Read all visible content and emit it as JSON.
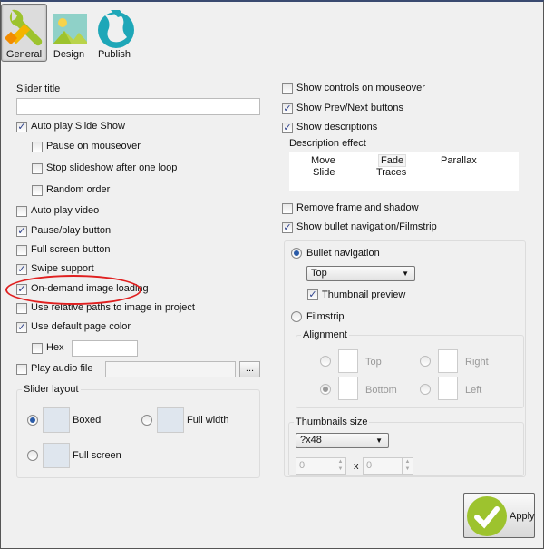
{
  "tabs": [
    {
      "label": "General",
      "selected": true,
      "icon": "wrench-icon"
    },
    {
      "label": "Design",
      "selected": false,
      "icon": "picture-icon"
    },
    {
      "label": "Publish",
      "selected": false,
      "icon": "globe-icon"
    }
  ],
  "left": {
    "slider_title_label": "Slider title",
    "slider_title_value": "",
    "options": [
      {
        "label": "Auto play Slide Show",
        "checked": true
      },
      {
        "label": "Pause on mouseover",
        "checked": false
      },
      {
        "label": "Stop slideshow after one loop",
        "checked": false
      },
      {
        "label": "Random order",
        "checked": false
      },
      {
        "label": "Auto play video",
        "checked": false
      },
      {
        "label": "Pause/play button",
        "checked": true
      },
      {
        "label": "Full screen button",
        "checked": false
      },
      {
        "label": "Swipe support",
        "checked": true
      },
      {
        "label": "On-demand image loading",
        "checked": true
      },
      {
        "label": "Use relative paths to image in project",
        "checked": false
      },
      {
        "label": "Use default page color",
        "checked": true
      },
      {
        "label": "Hex",
        "checked": false
      },
      {
        "label": "Play audio file",
        "checked": false
      }
    ],
    "browse_label": "...",
    "layout": {
      "title": "Slider layout",
      "options": [
        {
          "label": "Boxed",
          "selected": true
        },
        {
          "label": "Full width",
          "selected": false
        },
        {
          "label": "Full screen",
          "selected": false
        }
      ]
    }
  },
  "right": {
    "options": [
      {
        "label": "Show controls on mouseover",
        "checked": false
      },
      {
        "label": "Show Prev/Next buttons",
        "checked": true
      },
      {
        "label": "Show descriptions",
        "checked": true
      },
      {
        "label": "Remove frame and shadow",
        "checked": false
      },
      {
        "label": "Show bullet navigation/Filmstrip",
        "checked": true
      }
    ],
    "description_effect_label": "Description effect",
    "effects": [
      "Move",
      "Fade",
      "Parallax",
      "Slide",
      "Traces"
    ],
    "selected_effect": "Fade",
    "bullet_navigation": {
      "label": "Bullet navigation",
      "selected": true,
      "position": "Top",
      "thumbnail_preview": {
        "label": "Thumbnail preview",
        "checked": true
      }
    },
    "filmstrip": {
      "label": "Filmstrip",
      "selected": false
    },
    "alignment": {
      "title": "Alignment",
      "options": [
        {
          "label": "Top",
          "selected": false
        },
        {
          "label": "Bottom",
          "selected": true
        },
        {
          "label": "Right",
          "selected": false
        },
        {
          "label": "Left",
          "selected": false
        }
      ]
    },
    "thumbnails": {
      "title": "Thumbnails size",
      "size": "?x48",
      "width": "0",
      "height": "0",
      "x_label": "x"
    }
  },
  "apply_label": "Apply",
  "colors": {
    "highlight": "#e02020",
    "apply_icon": "#9dc32e",
    "wrench": "#9dc32e"
  }
}
